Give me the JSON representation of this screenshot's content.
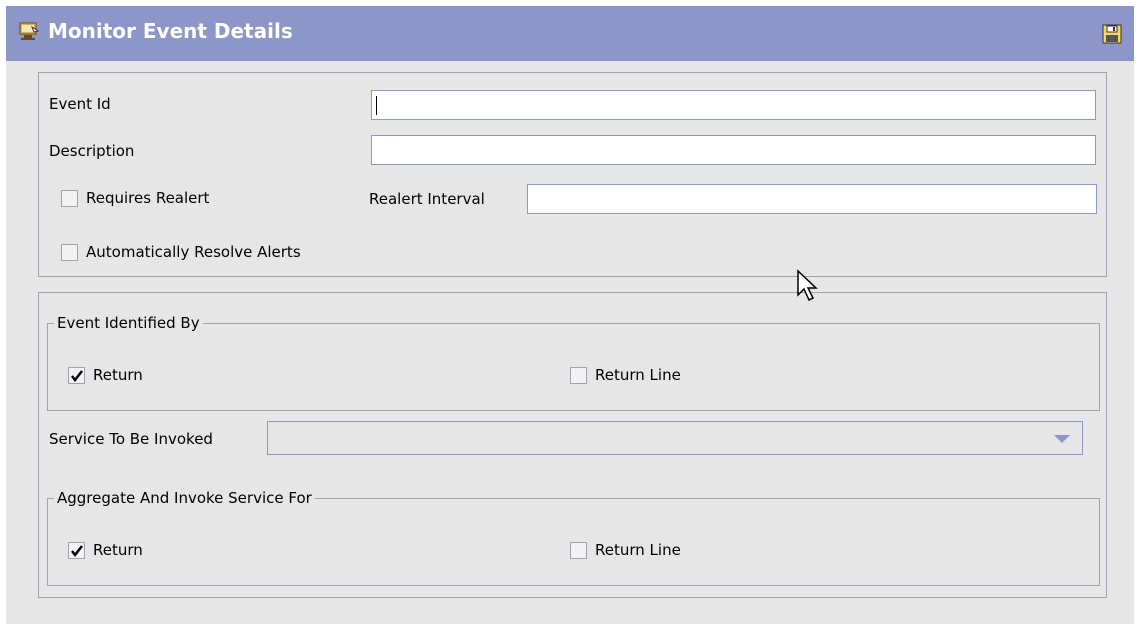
{
  "window": {
    "title": "Monitor Event Details",
    "accent_color": "#8c96c8",
    "icons": [
      "monitor-app-icon",
      "save-icon"
    ]
  },
  "form": {
    "event_id": {
      "label": "Event Id",
      "value": ""
    },
    "description": {
      "label": "Description",
      "value": ""
    },
    "requires_realert": {
      "label": "Requires Realert",
      "checked": false
    },
    "realert_interval": {
      "label": "Realert Interval",
      "value": ""
    },
    "auto_resolve": {
      "label": "Automatically Resolve Alerts",
      "checked": false
    }
  },
  "event_identified_by": {
    "legend": "Event Identified By",
    "return": {
      "label": "Return",
      "checked": true
    },
    "return_line": {
      "label": "Return Line",
      "checked": false
    }
  },
  "service": {
    "label": "Service To Be Invoked",
    "selected": ""
  },
  "aggregate": {
    "legend": "Aggregate And Invoke Service For",
    "return": {
      "label": "Return",
      "checked": true
    },
    "return_line": {
      "label": "Return Line",
      "checked": false
    }
  }
}
